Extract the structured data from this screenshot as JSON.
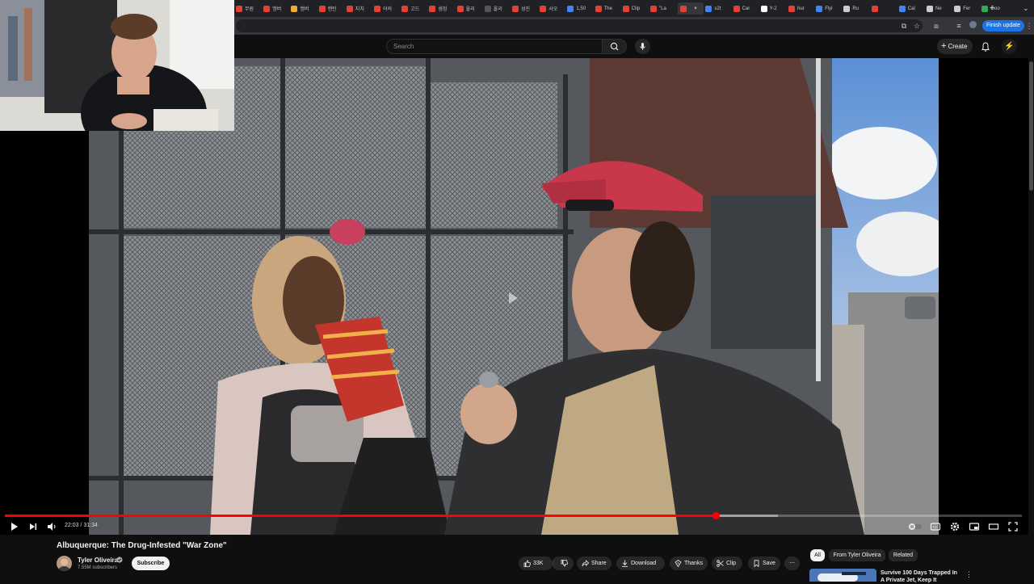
{
  "browser": {
    "tabs": [
      {
        "label": "무원",
        "color": "#e34133"
      },
      {
        "label": "앰버",
        "color": "#e34133"
      },
      {
        "label": "앰버",
        "color": "#f0a93b"
      },
      {
        "label": "캔틴",
        "color": "#e34133"
      },
      {
        "label": "지치",
        "color": "#e34133"
      },
      {
        "label": "어의",
        "color": "#e34133"
      },
      {
        "label": "고드",
        "color": "#e34133"
      },
      {
        "label": "샘징",
        "color": "#e34133"
      },
      {
        "label": "올리",
        "color": "#e34133"
      },
      {
        "label": "올리",
        "color": "#555555"
      },
      {
        "label": "성진",
        "color": "#e34133"
      },
      {
        "label": "사오",
        "color": "#e34133"
      },
      {
        "label": "1,50",
        "color": "#4285f4"
      },
      {
        "label": "The",
        "color": "#e34133"
      },
      {
        "label": "Clip",
        "color": "#e34133"
      },
      {
        "label": "\"La",
        "color": "#e34133"
      },
      {
        "label": "",
        "color": "#e34133"
      },
      {
        "label": "s2t",
        "color": "#4285f4"
      },
      {
        "label": "Car",
        "color": "#e34133"
      },
      {
        "label": "Y-2",
        "color": "#ffffff"
      },
      {
        "label": "hur",
        "color": "#e34133"
      },
      {
        "label": "Flyi",
        "color": "#4285f4"
      },
      {
        "label": "Ru",
        "color": "#cccccc"
      },
      {
        "label": "",
        "color": "#e34133"
      },
      {
        "label": "Cal",
        "color": "#4285f4"
      },
      {
        "label": "Ne",
        "color": "#cccccc"
      },
      {
        "label": "Fer",
        "color": "#cccccc"
      },
      {
        "label": "Goo",
        "color": "#34a853"
      }
    ],
    "finish_update_label": "Finish update"
  },
  "masthead": {
    "search_placeholder": "Search",
    "create_label": "Create"
  },
  "player": {
    "current_time": "22:03",
    "duration": "31:34",
    "time_text": "22:03 / 31:34",
    "progress_played_fraction": 0.699,
    "progress_buffered_fraction": 0.76
  },
  "video": {
    "title": "Albuquerque: The Drug-Infested \"War Zone\"",
    "channel_name": "Tyler Oliveira",
    "subscriber_count": "7.55M subscribers",
    "subscribe_label": "Subscribe",
    "like_count": "33K",
    "share_label": "Share",
    "download_label": "Download",
    "thanks_label": "Thanks",
    "clip_label": "Clip",
    "save_label": "Save"
  },
  "recommendations": {
    "chips": [
      "All",
      "From Tyler Oliveira",
      "Related"
    ],
    "first_title": "Survive 100 Days Trapped In A Private Jet, Keep It"
  },
  "colors": {
    "accent_red": "#ff0000",
    "update_blue": "#1a73e8",
    "background": "#0f0f0f"
  }
}
